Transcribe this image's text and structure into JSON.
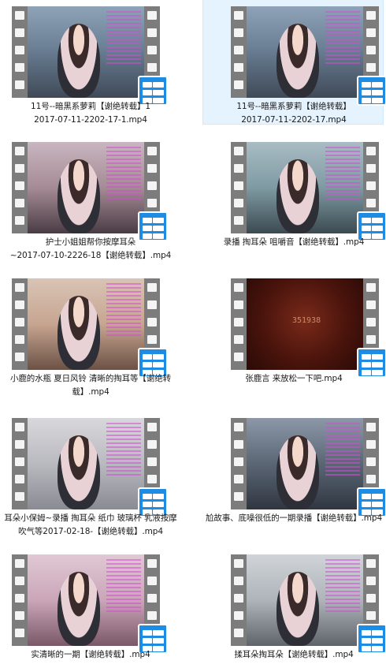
{
  "files": [
    {
      "name_line1": "11号--暗黑系萝莉【谢绝转载】1",
      "name_line2": "2017-07-11-2202-17-1.mp4",
      "scene": "room-blue",
      "selected": false
    },
    {
      "name_line1": "11号--暗黑系萝莉【谢绝转载】",
      "name_line2": "2017-07-11-2202-17.mp4",
      "scene": "room-blue",
      "selected": true
    },
    {
      "name_line1": "护士小姐姐帮你按摩耳朵",
      "name_line2": "~2017-07-10-2226-18【谢绝转载】.mp4",
      "scene": "room-pink",
      "selected": false
    },
    {
      "name_line1": "录播 掏耳朵 咀嚼音【谢绝转载】.mp4",
      "name_line2": "",
      "scene": "room-teal",
      "selected": false
    },
    {
      "name_line1": "小鹿的水瓶 夏日风铃 清晰的掏耳等【谢绝转",
      "name_line2": "载】.mp4",
      "scene": "room-warm",
      "selected": false
    },
    {
      "name_line1": "张鹿言 来放松一下吧.mp4",
      "name_line2": "",
      "scene": "dark-red",
      "selected": false
    },
    {
      "name_line1": "耳朵小保姆~录播 掏耳朵 纸巾 玻璃杯 乳液按摩",
      "name_line2": "吹气等2017-02-18-【谢绝转载】.mp4",
      "scene": "bed-grey",
      "selected": false
    },
    {
      "name_line1": "尬故事、底噪很低的一期录播【谢绝转载】.mp4",
      "name_line2": "",
      "scene": "room-dark",
      "selected": false
    },
    {
      "name_line1": "实清晰的一期【谢绝转载】.mp4",
      "name_line2": "",
      "scene": "room-pink2",
      "selected": false
    },
    {
      "name_line1": "揉耳朵掏耳朵【谢绝转载】.mp4",
      "name_line2": "",
      "scene": "room-light",
      "selected": false
    }
  ],
  "overlay_text_1": "351938",
  "badge_icon": "video-app-icon",
  "colors": {
    "selected_bg": "#e5f3ff",
    "selected_border": "#cde8ff",
    "badge_blue": "#1e8ce3",
    "film_grey": "#7c7c7c"
  }
}
